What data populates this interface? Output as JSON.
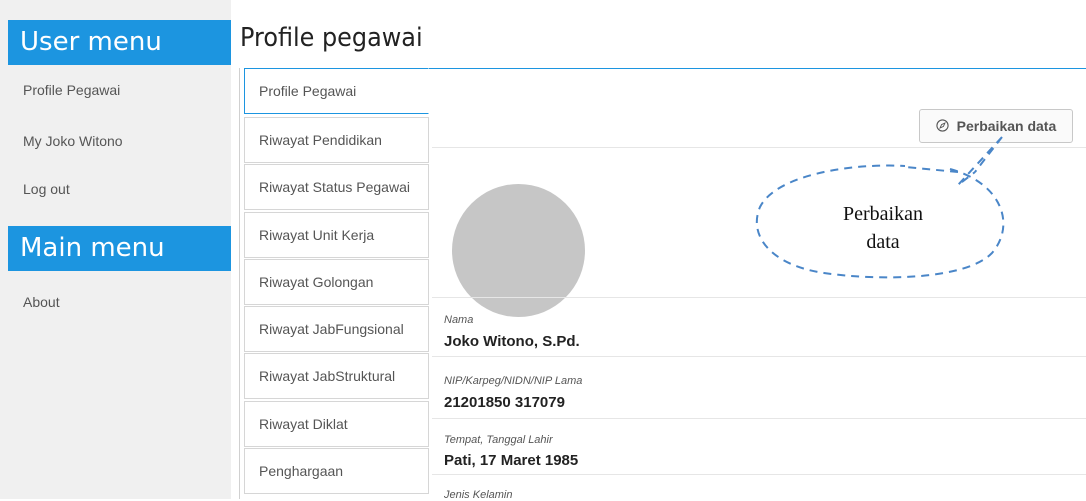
{
  "sidebar": {
    "user_menu_title": "User menu",
    "user_items": [
      "Profile Pegawai",
      "My Joko Witono",
      "Log out"
    ],
    "main_menu_title": "Main menu",
    "main_items": [
      "About"
    ]
  },
  "page": {
    "title": "Profile pegawai"
  },
  "tabs": [
    "Profile Pegawai",
    "Riwayat Pendidikan",
    "Riwayat Status Pegawai",
    "Riwayat Unit Kerja",
    "Riwayat Golongan",
    "Riwayat JabFungsional",
    "Riwayat JabStruktural",
    "Riwayat Diklat",
    "Penghargaan"
  ],
  "actions": {
    "edit_label": "Perbaikan data",
    "edit_icon": "compass-icon"
  },
  "annotation": {
    "line1": "Perbaikan",
    "line2": "data"
  },
  "fields": [
    {
      "label": "Nama",
      "value": "Joko Witono, S.Pd."
    },
    {
      "label": "NIP/Karpeg/NIDN/NIP Lama",
      "value": "21201850 317079"
    },
    {
      "label": "Tempat, Tanggal Lahir",
      "value": "Pati, 17 Maret 1985"
    },
    {
      "label": "Jenis Kelamin",
      "value": ""
    }
  ],
  "colors": {
    "accent": "#1c95e0",
    "avatar": "#c6c6c6",
    "callout_stroke": "#4a86c8"
  }
}
